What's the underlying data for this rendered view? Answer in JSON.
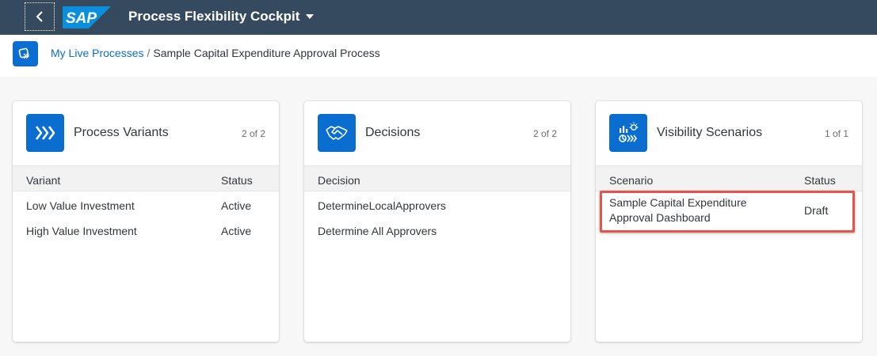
{
  "shell": {
    "logo_text": "SAP",
    "app_title": "Process Flexibility Cockpit",
    "brand_color": "#354a5f",
    "accent_color": "#0a6ed1",
    "icons": {
      "back": "back-arrow-icon",
      "menu": "caret-down-icon"
    }
  },
  "breadcrumb": {
    "link": "My Live Processes",
    "separator": "/",
    "current": "Sample Capital Expenditure Approval Process",
    "icon": "process-icon"
  },
  "cards": [
    {
      "title": "Process Variants",
      "count": "2 of 2",
      "icon": "process-variants-icon",
      "columns": [
        "Variant",
        "Status"
      ],
      "rows": [
        {
          "name": "Low Value Investment",
          "status": "Active"
        },
        {
          "name": "High Value Investment",
          "status": "Active"
        }
      ]
    },
    {
      "title": "Decisions",
      "count": "2 of 2",
      "icon": "handshake-icon",
      "columns": [
        "Decision"
      ],
      "rows": [
        {
          "name": "DetermineLocalApprovers"
        },
        {
          "name": "Determine All Approvers"
        }
      ]
    },
    {
      "title": "Visibility Scenarios",
      "count": "1 of 1",
      "icon": "visibility-scenarios-icon",
      "columns": [
        "Scenario",
        "Status"
      ],
      "rows": [
        {
          "name_line1": "Sample Capital Expenditure",
          "name_line2": "Approval Dashboard",
          "status": "Draft"
        }
      ],
      "highlight_color": "#e8524a"
    }
  ]
}
